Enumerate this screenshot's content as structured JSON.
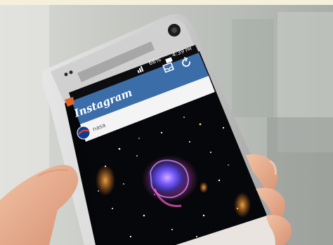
{
  "status_bar": {
    "battery": "66%",
    "time": "4:39",
    "ampm": "PM"
  },
  "app": {
    "name": "Instagram",
    "username": "nasa",
    "header_color": "#3b6ea8"
  },
  "icons": [
    "inbox-icon",
    "refresh-icon",
    "nasa-avatar-icon"
  ]
}
